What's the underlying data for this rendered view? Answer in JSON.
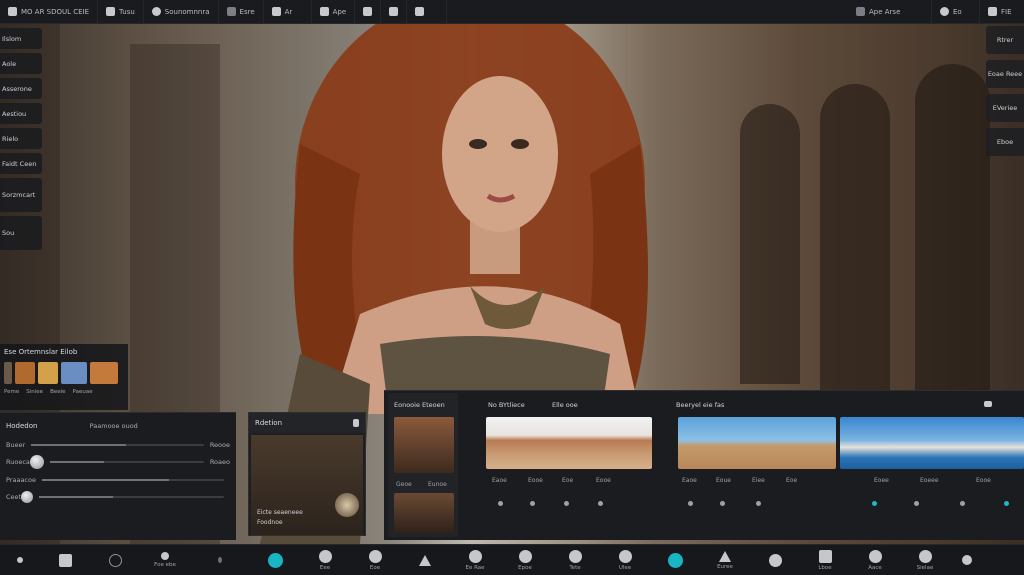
{
  "topbar": {
    "items": [
      {
        "label": "MO AR SDOUL CEIE",
        "icon": "video-icon"
      },
      {
        "label": "Tusu",
        "icon": "layers-icon"
      },
      {
        "label": "Sounomnnra",
        "icon": "camera-icon"
      },
      {
        "label": "Esre",
        "icon": "square-icon"
      },
      {
        "label": "Ar",
        "icon": "pen-icon"
      },
      {
        "label": "Ape",
        "icon": "cursor-icon"
      },
      {
        "label": "",
        "icon": "image-icon"
      },
      {
        "label": "",
        "icon": "brush-icon"
      },
      {
        "label": "",
        "icon": "plane-icon"
      }
    ],
    "right": [
      {
        "label": "Ape Arse",
        "icon": "badge-icon"
      },
      {
        "label": "Eo",
        "icon": "profile-icon"
      },
      {
        "label": "FIE",
        "icon": "settings-icon"
      }
    ]
  },
  "left_stack": [
    "Ilslom",
    "Aole",
    "Asserone",
    "Aestiou",
    "Rielo",
    "Faidt Ceen",
    "Sorzmcart",
    "Sou"
  ],
  "right_stack": [
    "Rtrer",
    "Eoae Reee",
    "EVeriee",
    "Eboe"
  ],
  "thumb_panel": {
    "title": "Ese Ortemnslar Eilob",
    "labels": [
      "Peme",
      "Siniee",
      "Beeie",
      "Paeuae"
    ],
    "colors": [
      "#b06a2e",
      "#d4a14a",
      "#6a8ec2",
      "#c47a3a"
    ]
  },
  "bottom_left": {
    "title": "Hodedon",
    "subtitle": "Paamooe ouod",
    "rows": [
      {
        "label": "Bueer",
        "value": "Reooe",
        "fill": 0.55
      },
      {
        "label": "Ruoeca",
        "value": "Roaeo",
        "fill": 0.35
      },
      {
        "label": "Praaacoe",
        "value": "",
        "fill": 0.7
      },
      {
        "label": "Ceet",
        "value": "",
        "fill": 0.4
      }
    ]
  },
  "mid_card": {
    "title": "Rdetion",
    "caption_a": "Eicte seaeneee",
    "caption_b": "Foodnoe"
  },
  "gallery": {
    "left_thumb": {
      "title": "Eonooie Eteoen",
      "labels": [
        "Geoe",
        "Eunoe"
      ]
    },
    "sections": [
      {
        "title": "No BYtliece",
        "extra": "Elle ooe"
      },
      {
        "title": "Beeryel eie fas",
        "extra": ""
      }
    ],
    "card_labels": [
      [
        "Eaoe",
        "Eooe",
        "Eoe",
        "Eooe"
      ],
      [
        "Eaoe",
        "Eoue",
        "Eiee",
        "Eoe"
      ],
      [
        "Eoee",
        "Eoeee",
        "Eooe"
      ]
    ],
    "dot_color": "#1fb8c4"
  },
  "bottom_bar": [
    {
      "label": "",
      "icon": "plus-icon"
    },
    {
      "label": "",
      "icon": "feather-icon"
    },
    {
      "label": "",
      "icon": "circle-icon"
    },
    {
      "label": "Foe ebe",
      "icon": "flag-icon"
    },
    {
      "label": "",
      "icon": "chevron-icon"
    },
    {
      "label": "",
      "icon": "magic-icon"
    },
    {
      "label": "Eee",
      "icon": "lens-icon"
    },
    {
      "label": "Eoe",
      "icon": "aperture-icon"
    },
    {
      "label": "",
      "icon": "triangle-icon"
    },
    {
      "label": "Ee Rae",
      "icon": "tag-icon"
    },
    {
      "label": "Epoe",
      "icon": "eye-icon"
    },
    {
      "label": "Tete",
      "icon": "target-icon"
    },
    {
      "label": "Ulee",
      "icon": "hand-icon"
    },
    {
      "label": "",
      "icon": "magic-teal-icon"
    },
    {
      "label": "Euree",
      "icon": "mountain-icon"
    },
    {
      "label": "",
      "icon": "arc-icon"
    },
    {
      "label": "Lboe",
      "icon": "grid-icon"
    },
    {
      "label": "Aace",
      "icon": "shield-icon"
    },
    {
      "label": "Sielae",
      "icon": "globe-icon"
    },
    {
      "label": "",
      "icon": "more-icon"
    }
  ]
}
